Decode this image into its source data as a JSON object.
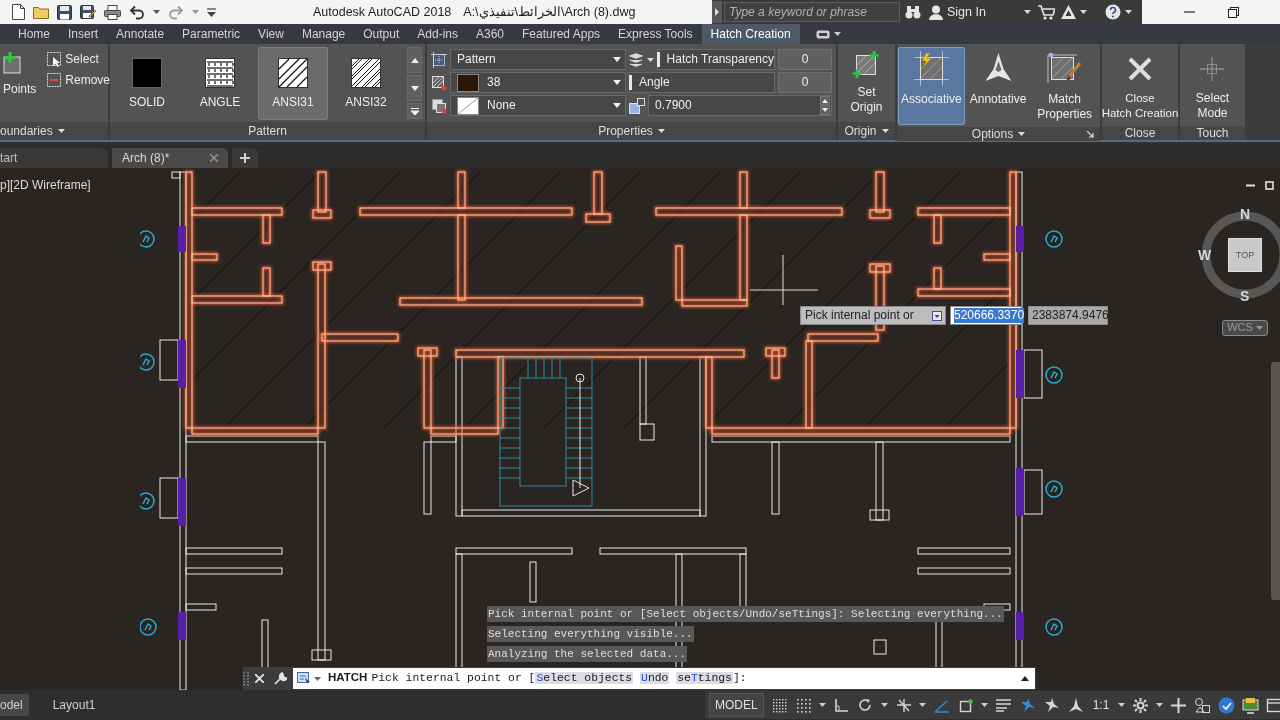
{
  "title_bar": {
    "app_title": "Autodesk AutoCAD 2018",
    "file_path": "A:\\الخرائط\\تنفيذي\\Arch (8).dwg",
    "search": {
      "placeholder": "Type a keyword or phrase"
    },
    "sign_in": "Sign In"
  },
  "ribbon_tabs": [
    {
      "label": "Home",
      "selected": false
    },
    {
      "label": "Insert",
      "selected": false
    },
    {
      "label": "Annotate",
      "selected": false
    },
    {
      "label": "Parametric",
      "selected": false
    },
    {
      "label": "View",
      "selected": false
    },
    {
      "label": "Manage",
      "selected": false
    },
    {
      "label": "Output",
      "selected": false
    },
    {
      "label": "Add-ins",
      "selected": false
    },
    {
      "label": "A360",
      "selected": false
    },
    {
      "label": "Featured Apps",
      "selected": false
    },
    {
      "label": "Express Tools",
      "selected": false
    },
    {
      "label": "Hatch Creation",
      "selected": true
    }
  ],
  "ribbon_panels": {
    "boundaries": {
      "title": "oundaries",
      "pick_points": "Points",
      "tools": [
        "Select",
        "Remove"
      ]
    },
    "pattern": {
      "title": "Pattern",
      "swatches": [
        {
          "label": "SOLID",
          "kind": "solid",
          "selected": false
        },
        {
          "label": "ANGLE",
          "kind": "angle",
          "selected": false
        },
        {
          "label": "ANSI31",
          "kind": "ansi31",
          "selected": true
        },
        {
          "label": "ANSI32",
          "kind": "ansi32",
          "selected": false
        }
      ]
    },
    "properties": {
      "title": "Properties",
      "hatch_type": "Pattern",
      "hatch_color": "38",
      "background_color": "None",
      "transparency": {
        "label": "Hatch Transparency",
        "value": "0",
        "level": 0
      },
      "angle": {
        "label": "Angle",
        "value": "0",
        "level": 0
      },
      "scale": "0.7900"
    },
    "origin": {
      "title": "Origin",
      "button": "Set\nOrigin"
    },
    "options": {
      "title": "Options",
      "buttons": [
        {
          "label": "Associative",
          "on": true
        },
        {
          "label": "Annotative",
          "on": false
        },
        {
          "label": "Match\nProperties",
          "on": false
        }
      ]
    },
    "close": {
      "title": "Close",
      "button": "Close\nHatch Creation"
    },
    "touch": {
      "title": "Touch",
      "button": "Select\nMode"
    }
  },
  "file_tabs": [
    {
      "label": "tart",
      "selected": false
    },
    {
      "label": "Arch (8)*",
      "selected": true
    }
  ],
  "viewport": {
    "label": "p][2D Wireframe]",
    "viewcube": {
      "north": "N",
      "west": "W",
      "south": "S",
      "face": "TOP",
      "ucs": "WCS"
    },
    "dynamic_input": {
      "prompt": "Pick internal point or",
      "fields": [
        {
          "value": "520666.3370",
          "selected": true
        },
        {
          "value": "2383874.9476",
          "selected": false
        }
      ]
    },
    "command_history": [
      "Pick internal point or [Select objects/Undo/seTtings]: Selecting everything...",
      "Selecting everything visible...",
      "Analyzing the selected data..."
    ],
    "command_line": {
      "command": "HATCH",
      "prompt": "Pick internal point or [",
      "options": [
        {
          "key": "S",
          "after": "elect objects"
        },
        {
          "key": "U",
          "after": "ndo"
        },
        {
          "before": "se",
          "key": "T",
          "after": "tings"
        }
      ],
      "end": "]:"
    }
  },
  "status_bar": {
    "layout_tabs": [
      {
        "label": "odel",
        "selected": true
      },
      {
        "label": "Layout1",
        "selected": false
      }
    ],
    "space": "MODEL",
    "annotation_scale": "1:1"
  }
}
